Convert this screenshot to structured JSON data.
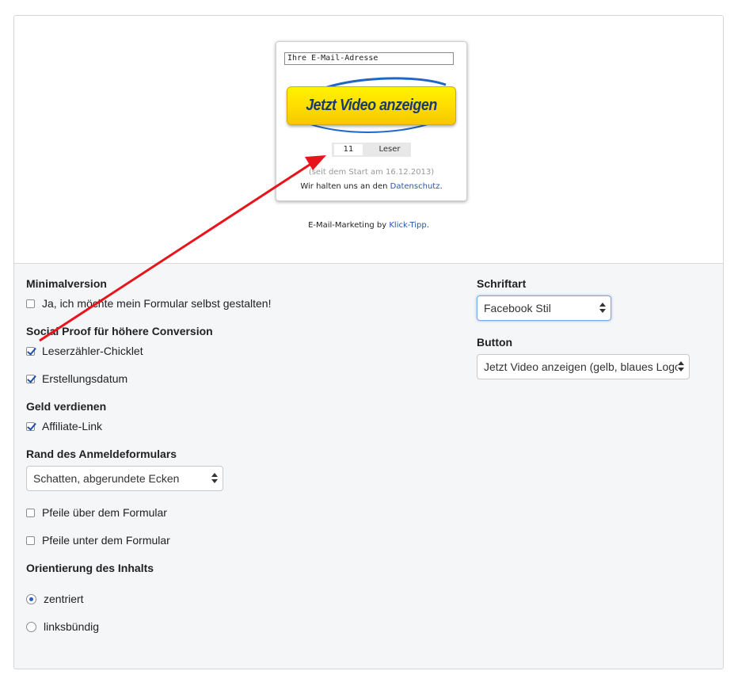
{
  "preview": {
    "email_placeholder": "Ihre E-Mail-Adresse",
    "cta_label": "Jetzt Video anzeigen",
    "counter_value": "11",
    "counter_label": "Leser",
    "since_text": "(seit dem Start am 16.12.2013)",
    "privacy_prefix": "Wir halten uns an den ",
    "privacy_link": "Datenschutz",
    "privacy_suffix": ".",
    "credit_prefix": "E-Mail-Marketing by ",
    "credit_link": "Klick-Tipp",
    "credit_suffix": "."
  },
  "settings": {
    "minimal_heading": "Minimalversion",
    "minimal_option": "Ja, ich möchte mein Formular selbst gestalten!",
    "social_heading": "Social Proof für höhere Conversion",
    "social_opt1": "Leserzähler-Chicklet",
    "social_opt2": "Erstellungsdatum",
    "money_heading": "Geld verdienen",
    "money_opt": "Affiliate-Link",
    "border_heading": "Rand des Anmeldeformulars",
    "border_select": "Schatten, abgerundete Ecken",
    "arrows_above": "Pfeile über dem Formular",
    "arrows_below": "Pfeile unter dem Formular",
    "orientation_heading": "Orientierung des Inhalts",
    "orient_center": "zentriert",
    "orient_left": "linksbündig",
    "font_heading": "Schriftart",
    "font_select": "Facebook Stil",
    "button_heading": "Button",
    "button_select": "Jetzt Video anzeigen (gelb, blaues Logo)"
  },
  "state": {
    "minimal_checked": false,
    "social_opt1_checked": true,
    "social_opt2_checked": true,
    "money_checked": true,
    "arrows_above_checked": false,
    "arrows_below_checked": false,
    "orientation": "zentriert"
  },
  "colors": {
    "cta_text": "#1d3a6e",
    "cta_yellow": "#ffe000",
    "link": "#2a55a8",
    "annotation_arrow": "#e8141c"
  }
}
